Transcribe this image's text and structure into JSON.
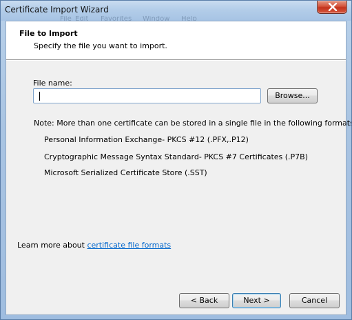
{
  "window": {
    "title": "Certificate Import Wizard",
    "background_menu": [
      "File",
      "Edit",
      "Favorites",
      "Window",
      "Help"
    ]
  },
  "header": {
    "title": "File to Import",
    "subtitle": "Specify the file you want to import."
  },
  "form": {
    "file_label": "File name:",
    "file_value": "",
    "browse_label": "Browse..."
  },
  "note": {
    "text": "Note:  More than one certificate can be stored in a single file in the following formats:",
    "formats": [
      "Personal Information Exchange- PKCS #12 (.PFX,.P12)",
      "Cryptographic Message Syntax Standard- PKCS #7 Certificates (.P7B)",
      "Microsoft Serialized Certificate Store (.SST)"
    ]
  },
  "learn_more": {
    "prefix": "Learn more about ",
    "link": "certificate file formats"
  },
  "buttons": {
    "back": "< Back",
    "next": "Next >",
    "cancel": "Cancel"
  },
  "colors": {
    "link": "#0066cc",
    "default_button_border": "#3c7fb1",
    "close_button": "#c3321c"
  },
  "icons": [
    "close-icon"
  ]
}
